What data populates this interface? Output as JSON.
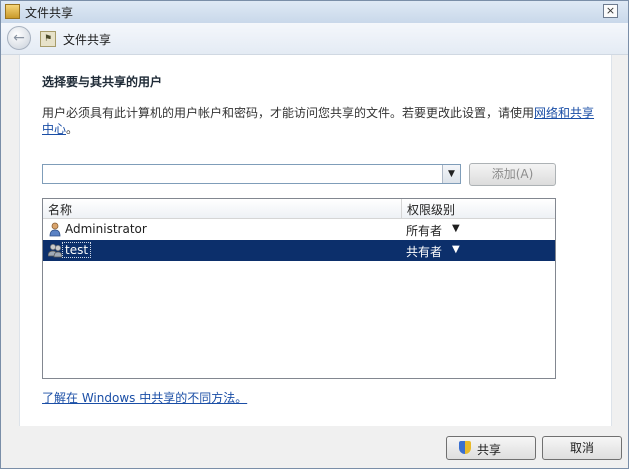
{
  "window": {
    "title": "文件共享",
    "close_glyph": "×"
  },
  "nav": {
    "back_glyph": "←",
    "title": "文件共享",
    "icon": "share-folder-icon"
  },
  "main": {
    "heading": "选择要与其共享的用户",
    "description_text": "用户必须具有此计算机的用户帐户和密码，才能访问您共享的文件。若要更改此设置，请使用",
    "description_link": "网络和共享中心",
    "description_end": "。",
    "user_combo": {
      "value": "",
      "placeholder": ""
    },
    "add_button": "添加(A)",
    "list": {
      "columns": [
        "名称",
        "权限级别"
      ],
      "rows": [
        {
          "name": "Administrator",
          "permission": "所有者",
          "icon": "user-icon",
          "selected": false
        },
        {
          "name": "test",
          "permission": "共有者",
          "icon": "group-icon",
          "selected": true
        }
      ]
    },
    "learn_link": "了解在 Windows 中共享的不同方法。"
  },
  "footer": {
    "share_button": "共享",
    "cancel_button": "取消"
  },
  "colors": {
    "selection": "#0c2f6b",
    "link": "#1a4ea6",
    "titlebar": "#c9d8ea"
  }
}
